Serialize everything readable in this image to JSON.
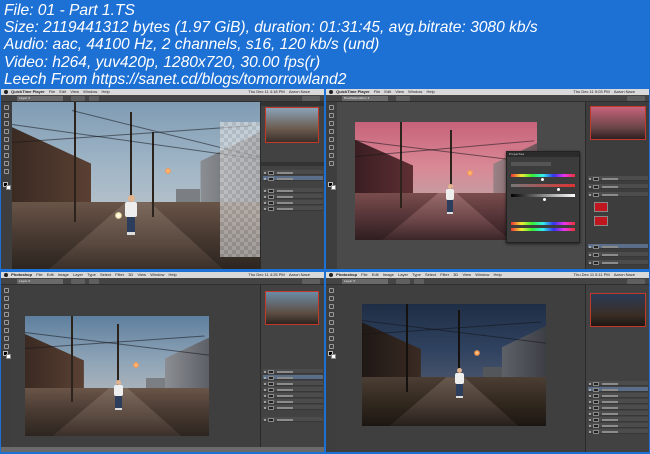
{
  "info_lines": [
    "File: 01 - Part 1.TS",
    "Size: 2119441312 bytes (1.97 GiB), duration: 01:31:45, avg.bitrate: 3080 kb/s",
    "Audio: aac, 44100 Hz, 2 channels, s16, 120 kb/s (und)",
    "Video: h264, yuv420p, 1280x720, 30.00 fps(r)",
    "Leech From https://sanet.cd/blogs/tomorrowland2"
  ],
  "colors": {
    "background": "#1d70d4",
    "info_text": "#ffffff",
    "app_gray": "#535353",
    "selection_red": "#c0392b",
    "tint_red": "#c0171f"
  },
  "thumbnails": [
    {
      "app_name": "QuickTime Player",
      "menu": [
        "File",
        "Edit",
        "View",
        "Window",
        "Help"
      ],
      "clock": "Thu Dec 11 4:18 PM",
      "user": "Aaron Nace",
      "doc_tab": "Layer 0",
      "layers": [
        "Layer 1",
        "Layer 0",
        "IMG_0789.psd",
        "IMG_0789.psd",
        "IMG_0789.psd"
      ]
    },
    {
      "app_name": "QuickTime Player",
      "menu": [
        "File",
        "Edit",
        "View",
        "Window",
        "Help"
      ],
      "clock": "Thu Dec 11 5:03 PM",
      "user": "Aaron Nace",
      "doc_tab": "Hue/Saturation 1",
      "dialog_title": "Properties",
      "layers": [
        "Color Fill 1",
        "Curves 1",
        "Hue/Saturation 1",
        "Layer 1",
        "Layer 0"
      ]
    },
    {
      "app_name": "Photoshop",
      "menu": [
        "File",
        "Edit",
        "Image",
        "Layer",
        "Type",
        "Select",
        "Filter",
        "3D",
        "View",
        "Window",
        "Help"
      ],
      "clock": "Thu Dec 11 4:25 PM",
      "user": "Aaron Nace",
      "doc_tab": "Layer 0",
      "layers": [
        "Group 1",
        "Layer 1",
        "IMG_0789.psd",
        "Curves 1",
        "Layer 0",
        "Group 2"
      ]
    },
    {
      "app_name": "Photoshop",
      "menu": [
        "File",
        "Edit",
        "Image",
        "Layer",
        "Type",
        "Select",
        "Filter",
        "3D",
        "View",
        "Window",
        "Help"
      ],
      "clock": "Thu Dec 11 5:11 PM",
      "user": "Aaron Nace",
      "doc_tab": "Layer 0",
      "layers": [
        "Group 1",
        "IMG_0789.psd",
        "Curves 2",
        "Layer 1",
        "Layer 0",
        "Curves 1"
      ]
    }
  ]
}
